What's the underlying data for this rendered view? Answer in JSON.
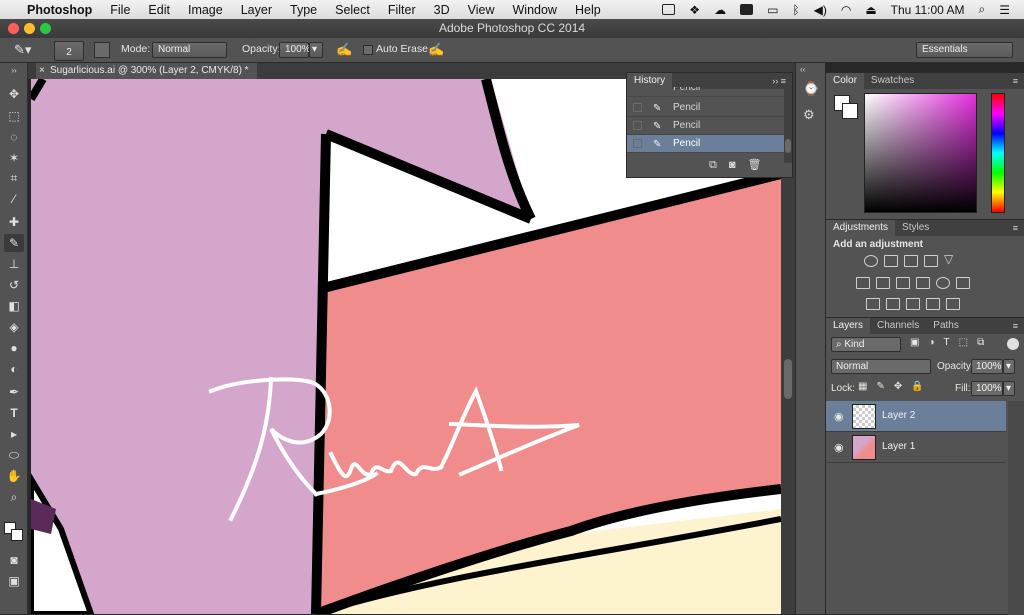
{
  "menubar": {
    "app": "Photoshop",
    "menus": [
      "File",
      "Edit",
      "Image",
      "Layer",
      "Type",
      "Select",
      "Filter",
      "3D",
      "View",
      "Window",
      "Help"
    ],
    "clock": "Thu 11:00 AM"
  },
  "window": {
    "title": "Adobe Photoshop CC 2014"
  },
  "options": {
    "brush_size": "2",
    "mode_label": "Mode:",
    "mode_value": "Normal",
    "opacity_label": "Opacity:",
    "opacity_value": "100%",
    "auto_erase": "Auto Erase",
    "workspace": "Essentials"
  },
  "document": {
    "tab_title": "Sugarlicious.ai @ 300% (Layer 2, CMYK/8) *",
    "close": "×"
  },
  "history": {
    "title": "History",
    "items": [
      "Pencil",
      "Pencil",
      "Pencil",
      "Pencil"
    ],
    "selected_index": 3
  },
  "color_panel": {
    "tabs": [
      "Color",
      "Swatches"
    ]
  },
  "adjustments_panel": {
    "tabs": [
      "Adjustments",
      "Styles"
    ],
    "heading": "Add an adjustment"
  },
  "layers_panel": {
    "tabs": [
      "Layers",
      "Channels",
      "Paths"
    ],
    "filter": "Kind",
    "blend_mode": "Normal",
    "opacity_label": "Opacity:",
    "opacity_value": "100%",
    "lock_label": "Lock:",
    "fill_label": "Fill:",
    "fill_value": "100%",
    "layers": [
      {
        "name": "Layer 2",
        "selected": true
      },
      {
        "name": "Layer 1",
        "selected": false
      }
    ]
  },
  "colors": {
    "selection": "#6b7f9a",
    "panel": "#535353",
    "canvas_purple": "#d4a6cc",
    "canvas_salmon": "#f08c8c",
    "canvas_cream": "#fdf3cf"
  }
}
